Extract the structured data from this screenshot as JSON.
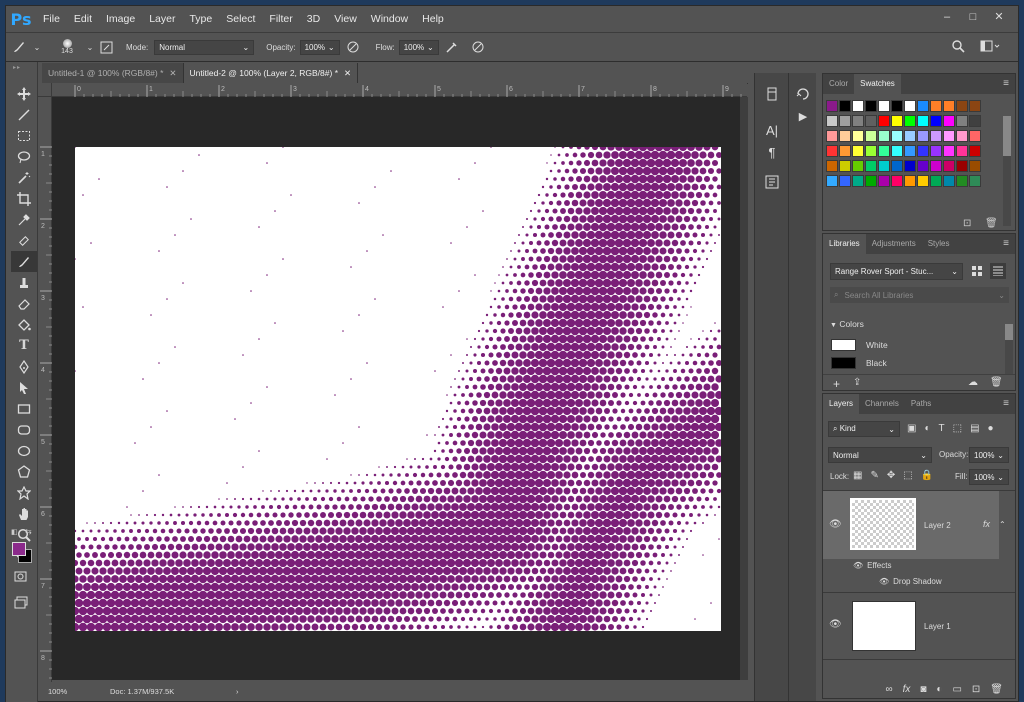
{
  "app": {
    "logo": "Ps"
  },
  "menu": [
    "File",
    "Edit",
    "Image",
    "Layer",
    "Type",
    "Select",
    "Filter",
    "3D",
    "View",
    "Window",
    "Help"
  ],
  "window_controls": [
    "–",
    "□",
    "✕"
  ],
  "options": {
    "brush_size": "143",
    "mode_label": "Mode:",
    "mode_value": "Normal",
    "opacity_label": "Opacity:",
    "opacity_value": "100%",
    "flow_label": "Flow:",
    "flow_value": "100%"
  },
  "tabs": [
    {
      "label": "Untitled-1 @ 100% (RGB/8#) *",
      "active": false
    },
    {
      "label": "Untitled-2 @ 100% (Layer 2, RGB/8#) *",
      "active": true
    }
  ],
  "ruler_top": [
    "0",
    "1",
    "2",
    "3",
    "4",
    "5",
    "6",
    "7",
    "8",
    "9"
  ],
  "ruler_left": [
    "1",
    "2",
    "3",
    "4",
    "5",
    "6",
    "7",
    "8",
    "9"
  ],
  "status": {
    "zoom": "100%",
    "doc": "Doc: 1.37M/937.5K"
  },
  "swatches_panel": {
    "tabs": [
      "Color",
      "Swatches"
    ],
    "rows": [
      [
        "#8b1a8b",
        "#000000",
        "#ffffff",
        "#000000",
        "#ffffff",
        "#000000",
        "#ffffff",
        "#1a8bff",
        "#ff7f27",
        "#ff7f27",
        "#8b4513",
        "#8b4513"
      ],
      [
        "#c8c8c8",
        "#a0a0a0",
        "#808080",
        "#606060",
        "#ff0000",
        "#ffff00",
        "#00ff00",
        "#00ffff",
        "#0000ff",
        "#ff00ff",
        "#808080",
        "#404040"
      ],
      [
        "#ff9999",
        "#ffcc99",
        "#ffff99",
        "#ccff99",
        "#99ffcc",
        "#99ffff",
        "#99ccff",
        "#9999ff",
        "#cc99ff",
        "#ff99ff",
        "#ff99cc",
        "#ff6666"
      ],
      [
        "#ff3333",
        "#ff9933",
        "#ffff33",
        "#99ff33",
        "#33ff99",
        "#33ffff",
        "#3399ff",
        "#3333ff",
        "#9933ff",
        "#ff33ff",
        "#ff3399",
        "#cc0000"
      ],
      [
        "#cc6600",
        "#cccc00",
        "#66cc00",
        "#00cc66",
        "#00cccc",
        "#0066cc",
        "#0000cc",
        "#6600cc",
        "#cc00cc",
        "#cc0066",
        "#990000",
        "#994c00"
      ],
      [
        "#33aaff",
        "#3366ff",
        "#00aa88",
        "#00aa00",
        "#aa00aa",
        "#ff0066",
        "#ff9900",
        "#ffcc00",
        "#00aa55",
        "#0088aa",
        "#228b22",
        "#2e8b57"
      ]
    ]
  },
  "libraries_panel": {
    "tabs": [
      "Libraries",
      "Adjustments",
      "Styles"
    ],
    "library": "Range Rover Sport - Stuc...",
    "search_placeholder": "Search All Libraries",
    "colors_heading": "Colors",
    "colors": [
      {
        "name": "White",
        "hex": "#ffffff"
      },
      {
        "name": "Black",
        "hex": "#000000"
      }
    ]
  },
  "layers_panel": {
    "tabs": [
      "Layers",
      "Channels",
      "Paths"
    ],
    "kind": "Kind",
    "blend": "Normal",
    "opacity_label": "Opacity:",
    "opacity_value": "100%",
    "lock_label": "Lock:",
    "fill_label": "Fill:",
    "fill_value": "100%",
    "layers": [
      {
        "name": "Layer 2",
        "fx": "fx",
        "effects_label": "Effects",
        "effect": "Drop Shadow"
      },
      {
        "name": "Layer 1"
      }
    ]
  },
  "colors": {
    "foreground": "#8b2a8b",
    "background": "#000000",
    "halftone": "#7a1f78"
  }
}
